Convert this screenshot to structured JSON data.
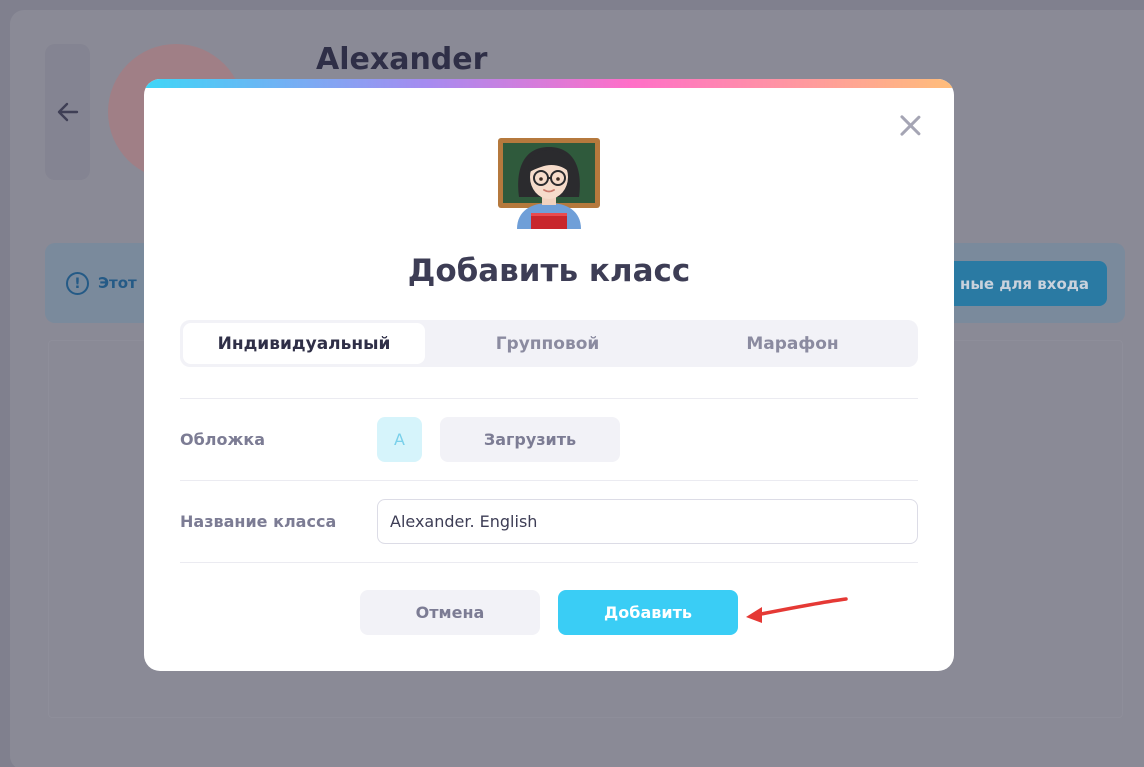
{
  "background": {
    "profile_name": "Alexander",
    "banner_text": "Этот",
    "login_button_label": "ные для входа"
  },
  "modal": {
    "title": "Добавить класс",
    "tabs": [
      {
        "label": "Индивидуальный",
        "active": true
      },
      {
        "label": "Групповой",
        "active": false
      },
      {
        "label": "Марафон",
        "active": false
      }
    ],
    "cover": {
      "label": "Обложка",
      "letter": "A",
      "upload_label": "Загрузить"
    },
    "class_name": {
      "label": "Название класса",
      "value": "Alexander. English"
    },
    "cancel_label": "Отмена",
    "add_label": "Добавить"
  },
  "colors": {
    "accent": "#3acdf5",
    "arrow": "#e53935",
    "title": "#3d3d55"
  },
  "icons": [
    "back-arrow-icon",
    "info-icon",
    "close-icon",
    "teacher-emoji-icon",
    "red-arrow-icon"
  ]
}
